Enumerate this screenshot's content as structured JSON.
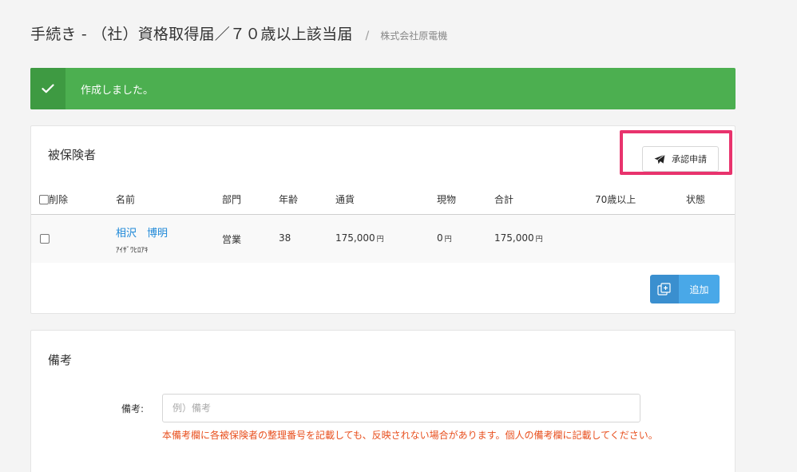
{
  "header": {
    "title": "手続き - （社）資格取得届／７０歳以上該当届",
    "separator": "/",
    "company": "株式会社原電機"
  },
  "alert": {
    "message": "作成しました。",
    "color": "#4caf50",
    "icon": "check-icon"
  },
  "insured_panel": {
    "title": "被保険者",
    "approve_button": {
      "label": "承認申請",
      "icon": "paper-plane-icon"
    },
    "columns": {
      "delete": "削除",
      "name": "名前",
      "department": "部門",
      "age": "年齢",
      "currency": "通貨",
      "in_kind": "現物",
      "total": "合計",
      "over70": "70歳以上",
      "status": "状態"
    },
    "rows": [
      {
        "name": "相沢　博明",
        "kana": "ｱｲｻﾞﾜﾋﾛｱｷ",
        "department": "営業",
        "age": "38",
        "currency": "175,000",
        "in_kind": "0",
        "total": "175,000",
        "yen": "円",
        "over70": "",
        "status": ""
      }
    ],
    "add_button": {
      "label": "追加",
      "icon": "add-card-icon"
    }
  },
  "notes_panel": {
    "title": "備考",
    "label": "備考:",
    "placeholder": "例）備考",
    "value": "",
    "warning": "本備考欄に各被保険者の整理番号を記載しても、反映されない場合があります。個人の備考欄に記載してください。"
  },
  "colors": {
    "success": "#4caf50",
    "link": "#1e88d8",
    "primary": "#49a8e8",
    "highlight": "#e8336d",
    "warning": "#e8501f"
  }
}
